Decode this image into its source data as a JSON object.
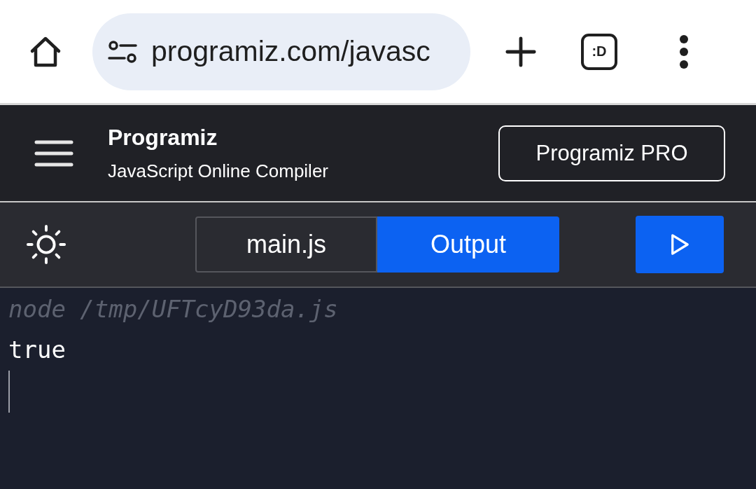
{
  "browser": {
    "url": "programiz.com/javasc",
    "tab_switcher": ":D"
  },
  "header": {
    "logo": "Programiz",
    "subtitle": "JavaScript Online Compiler",
    "pro_button": "Programiz PRO"
  },
  "tabs": [
    {
      "label": "main.js",
      "selected": false
    },
    {
      "label": "Output",
      "selected": true
    }
  ],
  "output": {
    "command": "node /tmp/UFTcyD93da.js",
    "lines": [
      "true"
    ]
  }
}
